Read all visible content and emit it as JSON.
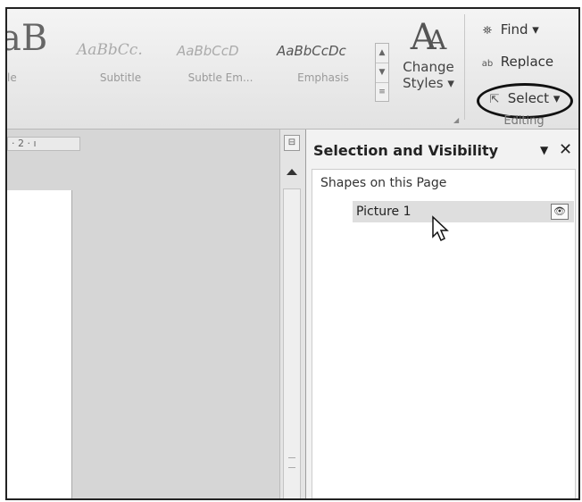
{
  "ribbon": {
    "styles": [
      {
        "sample": "aB",
        "name": "le"
      },
      {
        "sample": "AaBbCc.",
        "name": "Subtitle"
      },
      {
        "sample": "AaBbCcD",
        "name": "Subtle Em..."
      },
      {
        "sample": "AaBbCcDc",
        "name": "Emphasis"
      }
    ],
    "gallery_scroll": {
      "up": "▲",
      "more": "▼",
      "expand": "≡"
    },
    "change_styles": {
      "line1": "Change",
      "line2": "Styles ▾"
    },
    "editing": {
      "find_label": "Find ▾",
      "replace_label": "Replace",
      "select_label": "Select ▾",
      "group_label": "Editing"
    }
  },
  "document": {
    "ruler_text": "· 2 · ı",
    "ruler_toggle_icon": "⊟"
  },
  "selection_pane": {
    "title": "Selection and Visibility",
    "dropdown_glyph": "▼",
    "close_glyph": "✕",
    "shapes_label": "Shapes on this Page",
    "items": [
      {
        "name": "Picture 1",
        "visible": true
      }
    ],
    "eye_glyph": "👁"
  }
}
